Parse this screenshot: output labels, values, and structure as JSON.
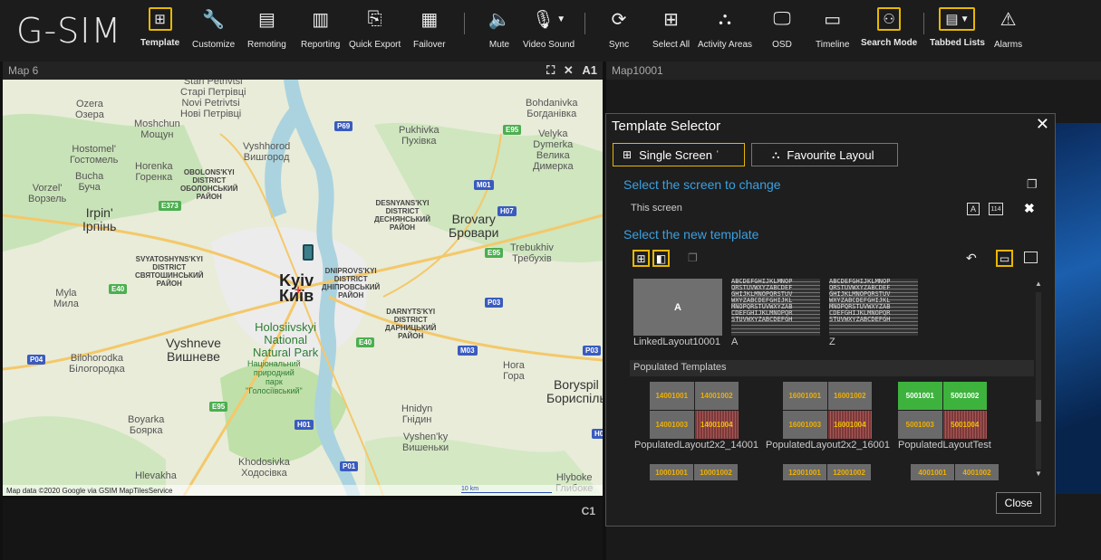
{
  "app": {
    "logo": "G-SIM"
  },
  "toolbar": {
    "items": [
      {
        "label": "Template",
        "icon": "template-grid-icon"
      },
      {
        "label": "Customize",
        "icon": "wrench-icon"
      },
      {
        "label": "Remoting",
        "icon": "remote-display-icon"
      },
      {
        "label": "Reporting",
        "icon": "reporting-icon"
      },
      {
        "label": "Quick Export",
        "icon": "export-icon"
      },
      {
        "label": "Failover",
        "icon": "failover-icon"
      },
      {
        "label": "Mute",
        "icon": "speaker-icon"
      },
      {
        "label": "Video Sound",
        "icon": "microphone-icon"
      },
      {
        "label": "Sync",
        "icon": "sync-icon"
      },
      {
        "label": "Select All",
        "icon": "select-all-icon"
      },
      {
        "label": "Activity Areas",
        "icon": "activity-areas-icon"
      },
      {
        "label": "OSD",
        "icon": "monitor-icon"
      },
      {
        "label": "Timeline",
        "icon": "timeline-icon"
      },
      {
        "label": "Search Mode",
        "icon": "search-mode-icon"
      },
      {
        "label": "Tabbed Lists",
        "icon": "tabbed-lists-icon"
      },
      {
        "label": "Alarms",
        "icon": "alarm-icon"
      }
    ]
  },
  "left_pane": {
    "title": "Map 6",
    "corner_label": "A1",
    "bottom_label": "C1",
    "map": {
      "footer": "Map data ©2020 Google via GSIM MapTilesService",
      "scale": "10 km",
      "labels": {
        "stari": "Starі Petrivtsі\nСтарі Петрівці",
        "novi": "Novi Petrivtsi\nНові Петрівці",
        "ozera": "Ozera\nОзера",
        "moshchun": "Moshchun\nМощун",
        "hostomel": "Hostomel'\nГостомель",
        "horenka": "Horenka\nГоренка",
        "bucha": "Bucha\nБуча",
        "vorzel": "Vorzel'\nВорзель",
        "irpin": "Irpin'\nІрпінь",
        "vyshhorod": "Vyshhorod\nВишгород",
        "obolon": "OBOLONS'KYI\nDISTRICT\nОБОЛОНСЬКИЙ\nРАЙОН",
        "pukhivka": "Pukhivka\nПухівка",
        "bohdanivka": "Bohdanivka\nБогданівка",
        "velyka": "Velyka\nDymerka\nВелика\nДимерка",
        "desnyansky": "DESNYANS'KYI\nDISTRICT\nДЕСНЯНСЬКИЙ\nРАЙОН",
        "brovary": "Brovary\nБровари",
        "trebukhiv": "Trebukhiv\nТребухів",
        "svyatoshyn": "SVYATOSHYNS'KYI\nDISTRICT\nСВЯТОШИНСЬКИЙ\nРАЙОН",
        "kyiv": "Kyiv\nКиїв",
        "dniprovsky": "DNIPROVS'KYI\nDISTRICT\nДНІПРОВСЬКИЙ\nРАЙОН",
        "darnytsky": "DARNYTS'KYI\nDISTRICT\nДАРНИЦЬКИЙ\nРАЙОН",
        "myla": "Myla\nМила",
        "vyshneve": "Vyshneve\nВишневе",
        "holosiivskyi": "Holosiivskyi\nNational\nNatural Park",
        "holosiivskyi_ua": "Національний\nприродний\nпарк\n\"Голосіївський\"",
        "bilohorodka": "Bilohorodka\nБілогородка",
        "hora": "Hora\nГора",
        "boryspil": "Boryspil\nБориспіль",
        "boyarka": "Boyarka\nБоярка",
        "hnidyn": "Hnidyn\nГнідин",
        "vyshenky": "Vyshen'ky\nВишеньки",
        "khodosivka": "Khodosivka\nХодосівка",
        "hlevakha": "Hlevakha",
        "hlyboke": "Hlyboke\nГлибоке"
      },
      "shields": {
        "p69": "P69",
        "e95a": "E95",
        "m01": "M01",
        "e373": "E373",
        "h07": "H07",
        "e95b": "E95",
        "e40a": "E40",
        "p03a": "P03",
        "e40b": "E40",
        "m03": "M03",
        "p03b": "P03",
        "p04": "P04",
        "e95c": "E95",
        "h01": "H01",
        "p01": "P01",
        "h0": "H0"
      }
    }
  },
  "right_pane": {
    "title": "Map10001"
  },
  "dialog": {
    "title": "Template Selector",
    "tabs": [
      {
        "label": "Single Screen ˈ"
      },
      {
        "label": "Favourite Layoul"
      }
    ],
    "select_screen_title": "Select the screen to change",
    "this_screen_label": "This screen",
    "screen_buttons": {
      "a": "A",
      "num": "114"
    },
    "select_template_title": "Select the new template",
    "templates": [
      {
        "name": "LinkedLayout10001",
        "thumb_text": "A"
      },
      {
        "name": "A"
      },
      {
        "name": "Z"
      }
    ],
    "grid_thumb_text": "ABCDEFGHIJKLMNOP\nQRSTUVWXYZABCDEF\nGHIJKLMNOPQRSTUV\nWXYZABCDEFGHIJKL\nMNOPQRSTUVWXYZAB\nCDEFGHIJKLMNOPQR\nSTUVWXYZABCDEFGH",
    "populated_header": "Populated Templates",
    "populated": [
      {
        "name": "PopulatedLayout2x2_14001",
        "cells": [
          "14001001",
          "14001002",
          "14001003",
          "14001004"
        ]
      },
      {
        "name": "PopulatedLayout2x2_16001",
        "cells": [
          "16001001",
          "16001002",
          "16001003",
          "16001004"
        ]
      },
      {
        "name": "PopulatedLayoutTest",
        "cells": [
          "5001001",
          "5001002",
          "5001003",
          "5001004"
        ]
      }
    ],
    "populated_row2": [
      [
        "10001001",
        "10001002"
      ],
      [
        "12001001",
        "12001002"
      ],
      [
        "4001001",
        "4001002"
      ]
    ],
    "close_label": "Close"
  }
}
